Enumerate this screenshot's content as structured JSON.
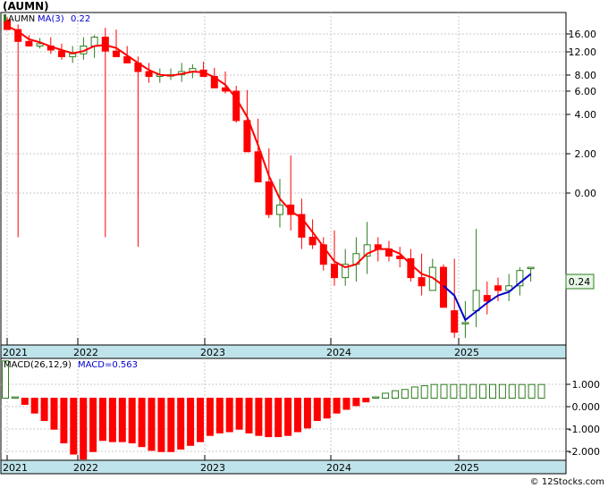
{
  "title": "(AUMN)",
  "legend": {
    "ticker": "AUMN",
    "ma_label": "MA(3)",
    "ma_value": "0.22",
    "macd_label": "MACD(26,12,9)",
    "macd_value_label": "MACD=0.563"
  },
  "last_price_label": "0.24",
  "footer": "© 12Stocks.com",
  "colors": {
    "up": "#2e7d1e",
    "down": "#ff0000",
    "ma_down": "#ff0000",
    "ma_up": "#0000cc",
    "axis_band": "#bfe3ea",
    "grid": "#c8c8c8"
  },
  "chart_data": [
    {
      "type": "candlestick",
      "scale": "log",
      "grid": true,
      "y_ticks": [
        "16.00",
        "12.00",
        "8.00",
        "6.00",
        "4.00",
        "2.00",
        "0.00"
      ],
      "x_labels": [
        "2021",
        "2022",
        "2023",
        "2024",
        "2025"
      ],
      "series": {
        "open": [
          18,
          15,
          12,
          11,
          11,
          10,
          9,
          9.5,
          11,
          13,
          10,
          9,
          8,
          6.8,
          6.2,
          6.4,
          6.4,
          6.8,
          7,
          6.2,
          5,
          4.7,
          2.7,
          1.5,
          0.85,
          0.46,
          0.55,
          0.46,
          0.3,
          0.26,
          0.18,
          0.14,
          0.18,
          0.21,
          0.26,
          0.24,
          0.21,
          0.2,
          0.14,
          0.11,
          0.17,
          0.075,
          0.06,
          0.075,
          0.1,
          0.12,
          0.11,
          0.12,
          0.17
        ],
        "high": [
          19,
          16.5,
          13.5,
          12.8,
          13,
          11.5,
          11,
          13,
          13.5,
          15.5,
          15,
          11,
          9,
          8,
          7.2,
          7.2,
          8,
          7.8,
          8.2,
          7.3,
          6.8,
          5.2,
          4.8,
          2.8,
          1.6,
          0.9,
          1.4,
          0.62,
          0.42,
          0.3,
          0.34,
          0.24,
          0.3,
          0.4,
          0.3,
          0.28,
          0.25,
          0.24,
          0.22,
          0.2,
          0.18,
          0.2,
          0.09,
          0.35,
          0.13,
          0.14,
          0.15,
          0.17,
          0.17
        ],
        "low": [
          16,
          0.3,
          11,
          10.5,
          9.5,
          8.5,
          8,
          8.5,
          8.8,
          0.3,
          9.5,
          8,
          0.25,
          5.5,
          5.5,
          5.8,
          5.6,
          6,
          6.2,
          5.1,
          4.5,
          2.6,
          1.5,
          0.85,
          0.43,
          0.36,
          0.34,
          0.24,
          0.24,
          0.16,
          0.12,
          0.12,
          0.13,
          0.15,
          0.19,
          0.19,
          0.17,
          0.13,
          0.1,
          0.11,
          0.11,
          0.045,
          0.045,
          0.055,
          0.07,
          0.09,
          0.09,
          0.1,
          0.13
        ],
        "close": [
          15,
          12,
          11,
          11.5,
          10.2,
          9,
          9.5,
          11,
          13,
          10,
          9,
          8,
          6.8,
          6.2,
          6.4,
          6.4,
          6.8,
          7.2,
          6.2,
          5,
          4.7,
          2.7,
          1.5,
          0.85,
          0.46,
          0.55,
          0.46,
          0.3,
          0.26,
          0.18,
          0.14,
          0.18,
          0.22,
          0.26,
          0.24,
          0.21,
          0.2,
          0.14,
          0.12,
          0.17,
          0.08,
          0.05,
          0.06,
          0.11,
          0.09,
          0.11,
          0.12,
          0.16,
          0.17
        ],
        "ma3": [
          16,
          14.5,
          12.5,
          11.8,
          10.9,
          10.2,
          9.6,
          10,
          11,
          11.2,
          10.6,
          9.2,
          8,
          7,
          6.4,
          6.3,
          6.5,
          6.8,
          6.7,
          6.1,
          5.3,
          4.1,
          2.9,
          1.7,
          0.95,
          0.62,
          0.49,
          0.43,
          0.33,
          0.25,
          0.19,
          0.17,
          0.18,
          0.22,
          0.24,
          0.24,
          0.22,
          0.18,
          0.15,
          0.14,
          0.12,
          0.1,
          0.063,
          0.074,
          0.087,
          0.1,
          0.107,
          0.127,
          0.15
        ]
      }
    },
    {
      "type": "bar",
      "title": "MACD(26,12,9)",
      "y_ticks": [
        "1.000",
        "0.000",
        "-1.000",
        "-2.000"
      ],
      "ylim": [
        -2.5,
        1.6
      ],
      "x_labels": [
        "2021",
        "2022",
        "2023",
        "2024",
        "2025"
      ],
      "values": [
        1.5,
        0.05,
        -0.25,
        -0.6,
        -0.9,
        -1.25,
        -1.8,
        -2.25,
        -2.45,
        -2.15,
        -1.7,
        -1.75,
        -1.75,
        -1.8,
        -1.95,
        -2.1,
        -2.15,
        -2.15,
        -2.05,
        -1.9,
        -1.75,
        -1.5,
        -1.4,
        -1.35,
        -1.25,
        -1.4,
        -1.5,
        -1.55,
        -1.55,
        -1.5,
        -1.35,
        -1.2,
        -0.9,
        -0.8,
        -0.6,
        -0.45,
        -0.3,
        -0.15,
        0.05,
        0.2,
        0.3,
        0.35,
        0.45,
        0.5,
        0.55,
        0.55,
        0.55,
        0.55,
        0.55,
        0.55,
        0.55,
        0.55,
        0.55,
        0.55,
        0.55,
        0.55
      ]
    }
  ]
}
